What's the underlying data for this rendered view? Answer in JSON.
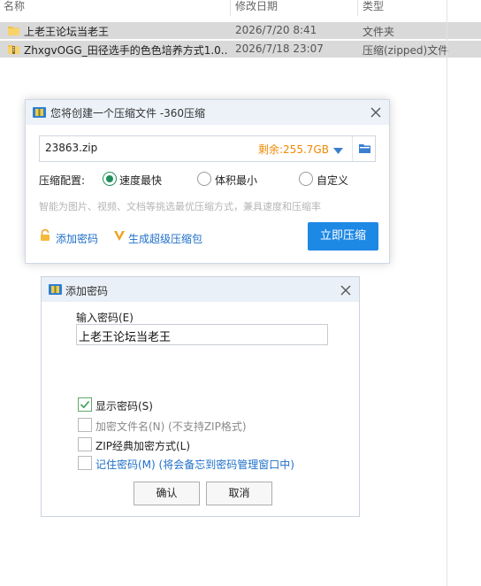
{
  "explorer": {
    "columns": {
      "name": "名称",
      "date": "修改日期",
      "type": "类型"
    },
    "files": [
      {
        "name": "上老王论坛当老王",
        "date": "2026/7/20 8:41",
        "type": "文件夹",
        "icon": "folder-icon"
      },
      {
        "name": "ZhxgvOGG_田径选手的色色培养方式1.0...",
        "date": "2026/7/18 23:07",
        "type": "压缩(zipped)文件",
        "icon": "zip-folder-icon"
      }
    ]
  },
  "compress_dialog": {
    "title": "您将创建一个压缩文件 -360压缩",
    "filename": "23863.zip",
    "free_space": "剩余:255.7GB",
    "config_label": "压缩配置:",
    "options": [
      "速度最快",
      "体积最小",
      "自定义"
    ],
    "selected_option": "速度最快",
    "hint": "智能为图片、视频、文档等挑选最优压缩方式，兼具速度和压缩率",
    "add_password": "添加密码",
    "make_sfx": "生成超级压缩包",
    "compress_now": "立即压缩"
  },
  "password_dialog": {
    "title": "添加密码",
    "input_label": "输入密码(E)",
    "password_value": "上老王论坛当老王",
    "checkboxes": [
      {
        "label": "显示密码(S)",
        "checked": true
      },
      {
        "label": "加密文件名(N) (不支持ZIP格式)",
        "checked": false
      },
      {
        "label": "ZIP经典加密方式(L)",
        "checked": false
      },
      {
        "label": "记住密码(M) (将会备忘到密码管理窗口中)",
        "checked": false
      }
    ],
    "ok": "确认",
    "cancel": "取消"
  },
  "colors": {
    "accent": "#1e88e5",
    "warn": "#f08a00",
    "checked": "#1e8f5a"
  }
}
